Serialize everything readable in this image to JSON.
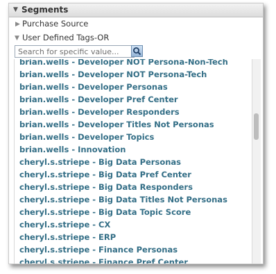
{
  "panel": {
    "title": "Segments",
    "sections": [
      {
        "label": "Purchase Source"
      },
      {
        "label": "User Defined Tags-OR"
      }
    ]
  },
  "search": {
    "placeholder": "Search for specific value..."
  },
  "items": [
    "brian.wells - Developer NOT Persona-Non-Tech",
    "brian.wells - Developer NOT Persona-Tech",
    "brian.wells - Developer Personas",
    "brian.wells - Developer Pref Center",
    "brian.wells - Developer Responders",
    "brian.wells - Developer Titles Not Personas",
    "brian.wells - Developer Topics",
    "brian.wells - Innovation",
    "cheryl.s.striepe - Big Data Personas",
    "cheryl.s.striepe - Big Data Pref Center",
    "cheryl.s.striepe - Big Data Responders",
    "cheryl.s.striepe - Big Data Titles Not Personas",
    "cheryl.s.striepe - Big Data Topic Score",
    "cheryl.s.striepe - CX",
    "cheryl.s.striepe - ERP",
    "cheryl.s.striepe - Finance Personas",
    "cheryl.s.striepe - Finance Pref Center"
  ]
}
